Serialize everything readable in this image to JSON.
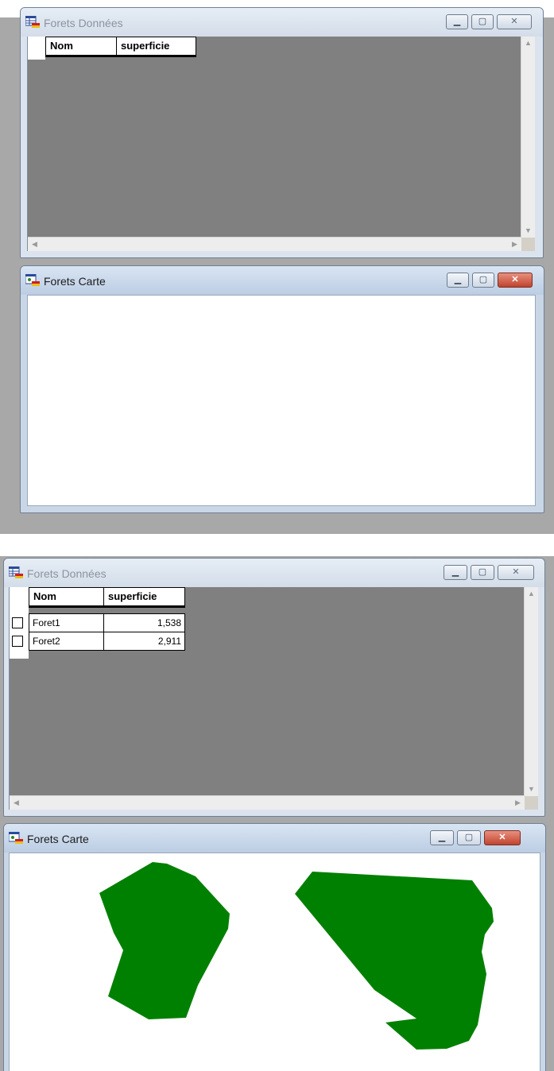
{
  "colors": {
    "grid_background": "#808080",
    "forest_fill": "#008000",
    "map_background": "#ffffff",
    "close_active": "#c8503a"
  },
  "top_panel": {
    "data_window": {
      "title": "Forets Données",
      "icon": "table-icon",
      "columns": [
        "Nom",
        "superficie"
      ],
      "rows": []
    },
    "map_window": {
      "title": "Forets Carte",
      "icon": "map-icon",
      "forests": []
    }
  },
  "bottom_panel": {
    "data_window": {
      "title": "Forets Données",
      "icon": "table-icon",
      "columns": [
        "Nom",
        "superficie"
      ],
      "rows": [
        {
          "nom": "Foret1",
          "superficie": "1,538"
        },
        {
          "nom": "Foret2",
          "superficie": "2,911"
        }
      ]
    },
    "map_window": {
      "title": "Forets Carte",
      "icon": "map-icon",
      "forests": [
        "Foret1",
        "Foret2"
      ]
    }
  },
  "window_controls": {
    "minimize": "minimize-icon",
    "maximize": "maximize-icon",
    "close": "close-icon"
  }
}
